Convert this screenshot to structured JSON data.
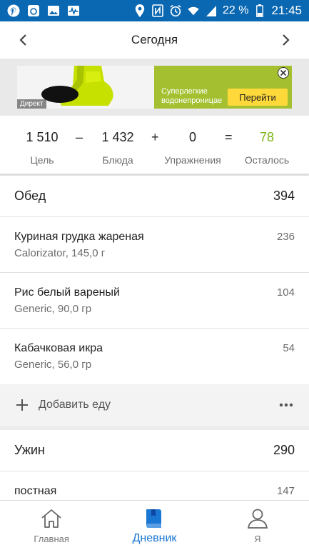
{
  "status_bar": {
    "battery": "22 %",
    "time": "21:45",
    "left_icons": [
      "pinterest-icon",
      "app-badge-icon",
      "gallery-icon",
      "activity-icon"
    ],
    "right_icons": [
      "location-icon",
      "nfc-icon",
      "alarm-icon",
      "wifi-icon",
      "signal-icon",
      "battery-icon"
    ]
  },
  "date_header": {
    "title": "Сегодня"
  },
  "ad": {
    "text_line1": "Суперлегкие",
    "text_line2": "водонепроницае",
    "button": "Перейти",
    "label": "Директ"
  },
  "summary": {
    "goal": {
      "value": "1 510",
      "label": "Цель"
    },
    "op1": "–",
    "food": {
      "value": "1 432",
      "label": "Блюда"
    },
    "op2": "+",
    "exercise": {
      "value": "0",
      "label": "Упражнения"
    },
    "op3": "=",
    "remaining": {
      "value": "78",
      "label": "Осталось"
    }
  },
  "meals": [
    {
      "name": "Обед",
      "calories": "394",
      "items": [
        {
          "name": "Куриная грудка жареная",
          "detail": "Calorizator, 145,0 г",
          "calories": "236"
        },
        {
          "name": "Рис белый вареный",
          "detail": "Generic, 90,0 гр",
          "calories": "104"
        },
        {
          "name": "Кабачковая икра",
          "detail": "Generic, 56,0 гр",
          "calories": "54"
        }
      ],
      "add_label": "Добавить еду"
    },
    {
      "name": "Ужин",
      "calories": "290",
      "items": [
        {
          "name": "постная",
          "detail": "",
          "calories": "147"
        }
      ]
    }
  ],
  "bottom_nav": {
    "home": "Главная",
    "diary": "Дневник",
    "me": "Я"
  },
  "colors": {
    "status_bar": "#0a68b3",
    "accent": "#1976d2",
    "remaining": "#7cb518",
    "ad_green": "#a4c030",
    "ad_button": "#ffd93a"
  }
}
